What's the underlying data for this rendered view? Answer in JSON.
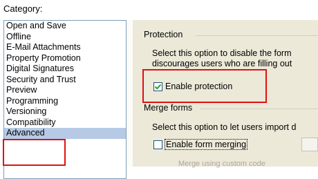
{
  "category": {
    "label": "Category:",
    "items": [
      {
        "label": "Open and Save",
        "selected": false
      },
      {
        "label": "Offline",
        "selected": false
      },
      {
        "label": "E-Mail Attachments",
        "selected": false
      },
      {
        "label": "Property Promotion",
        "selected": false
      },
      {
        "label": "Digital Signatures",
        "selected": false
      },
      {
        "label": "Security and Trust",
        "selected": false
      },
      {
        "label": "Preview",
        "selected": false
      },
      {
        "label": "Programming",
        "selected": false
      },
      {
        "label": "Versioning",
        "selected": false
      },
      {
        "label": "Compatibility",
        "selected": false
      },
      {
        "label": "Advanced",
        "selected": true
      }
    ]
  },
  "protection": {
    "title": "Protection",
    "desc_line1": "Select this option to disable the form",
    "desc_line2": "discourages users who are filling out",
    "checkbox_label": "Enable protection",
    "checked": true
  },
  "merge": {
    "title": "Merge forms",
    "desc_line1": "Select this option to let users import d",
    "checkbox_label": "Enable form merging",
    "checked": false,
    "sub_option": "Merge using custom code"
  },
  "colors": {
    "callout": "#e01010",
    "selection": "#b6cae6",
    "panel": "#ece9d8",
    "checkmark": "#21a121"
  }
}
